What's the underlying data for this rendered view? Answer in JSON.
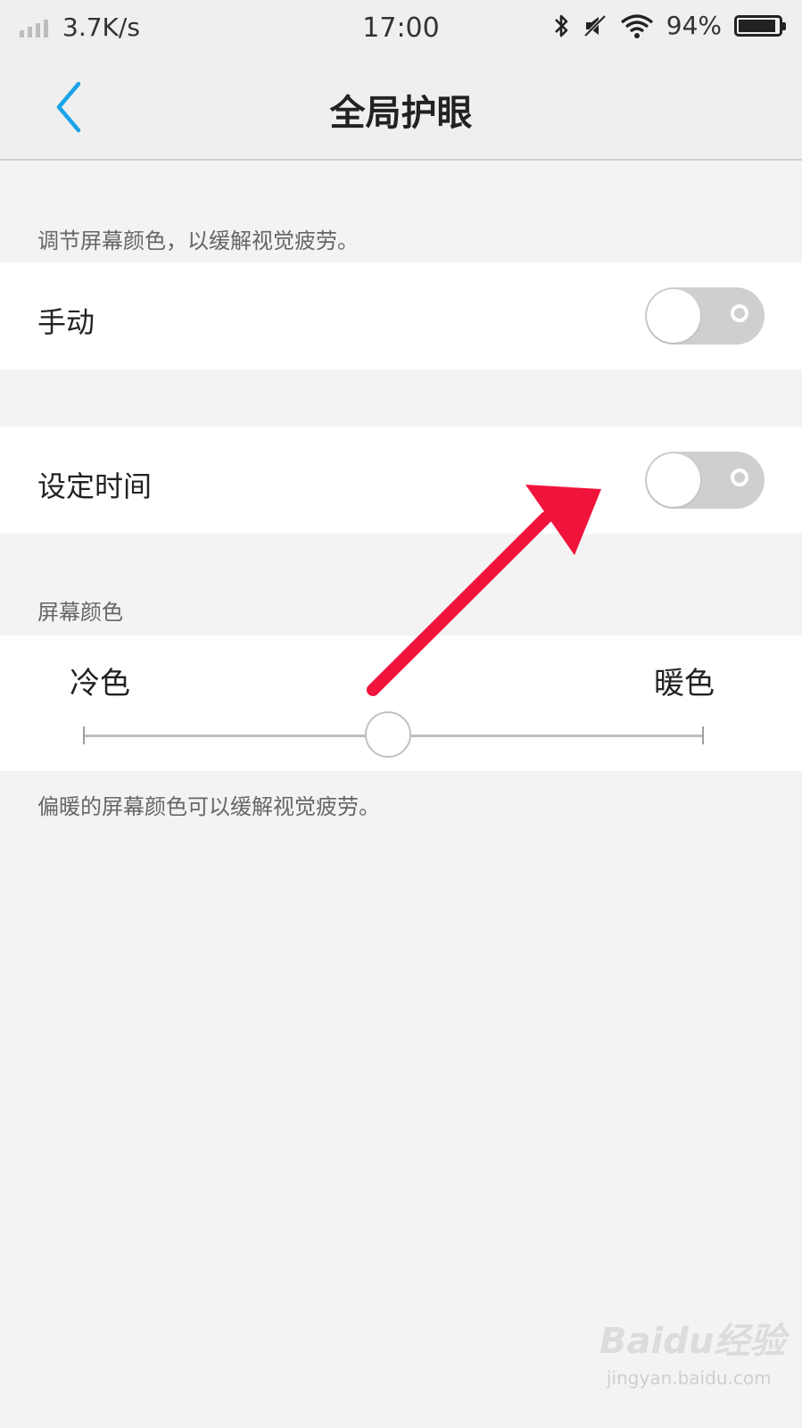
{
  "status_bar": {
    "net_speed": "3.7K/s",
    "time": "17:00",
    "battery_percent": "94%",
    "battery_level": 0.94,
    "icons": [
      "signal-icon",
      "bluetooth-icon",
      "mute-icon",
      "wifi-icon",
      "battery-icon"
    ]
  },
  "header": {
    "title": "全局护眼",
    "back_icon": "chevron-left-icon",
    "accent": "#1aa3e8"
  },
  "intro_caption": "调节屏幕颜色，以缓解视觉疲劳。",
  "rows": [
    {
      "label": "手动",
      "on": false
    },
    {
      "label": "设定时间",
      "on": false
    }
  ],
  "color_section": {
    "caption": "屏幕颜色",
    "cold_label": "冷色",
    "warm_label": "暖色",
    "slider_value": 0.5,
    "footnote": "偏暖的屏幕颜色可以缓解视觉疲劳。"
  },
  "annotation": {
    "arrow_color": "#f0143c"
  },
  "watermark": {
    "title": "Baidu经验",
    "url": "jingyan.baidu.com"
  }
}
